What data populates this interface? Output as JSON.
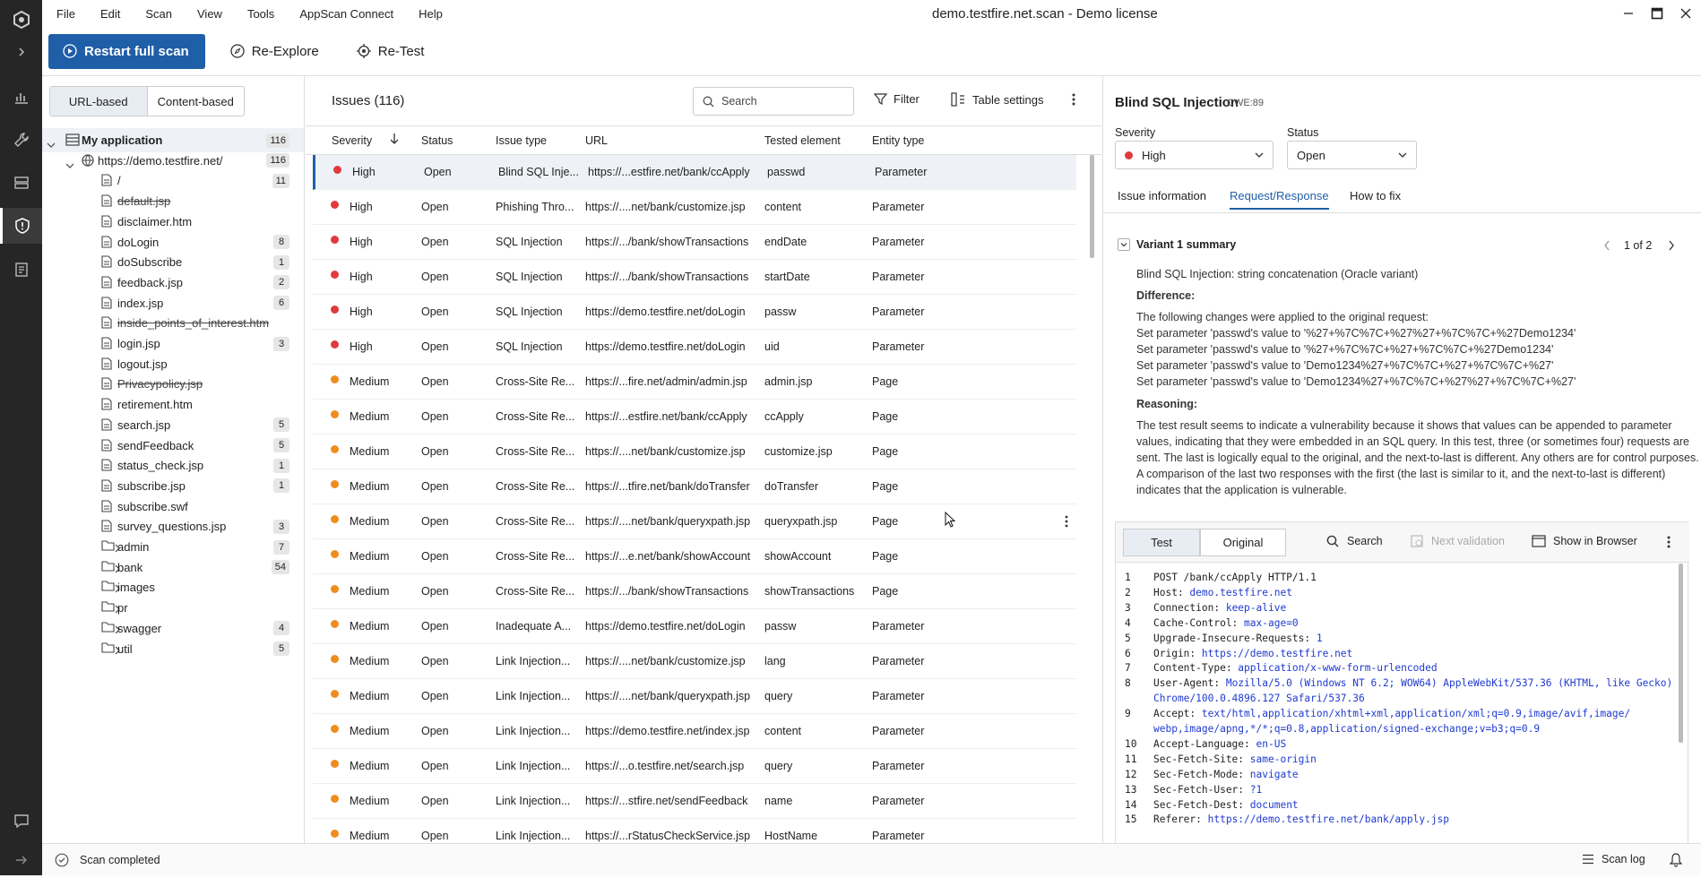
{
  "window": {
    "title": "demo.testfire.net.scan - Demo license"
  },
  "menu": [
    "File",
    "Edit",
    "Scan",
    "View",
    "Tools",
    "AppScan Connect",
    "Help"
  ],
  "toolbar": {
    "restart": "Restart full scan",
    "reexplore": "Re-Explore",
    "retest": "Re-Test"
  },
  "tree": {
    "tab_url": "URL-based",
    "tab_content": "Content-based",
    "items": [
      {
        "label": "My application",
        "count": "116",
        "kind": "app",
        "level": 0,
        "strike": false
      },
      {
        "label": "https://demo.testfire.net/",
        "count": "116",
        "kind": "globe",
        "level": 1,
        "strike": false
      },
      {
        "label": "/",
        "count": "11",
        "kind": "file",
        "level": 2,
        "strike": false
      },
      {
        "label": "default.jsp",
        "count": "",
        "kind": "file",
        "level": 2,
        "strike": true
      },
      {
        "label": "disclaimer.htm",
        "count": "",
        "kind": "file",
        "level": 2,
        "strike": false
      },
      {
        "label": "doLogin",
        "count": "8",
        "kind": "file",
        "level": 2,
        "strike": false
      },
      {
        "label": "doSubscribe",
        "count": "1",
        "kind": "file",
        "level": 2,
        "strike": false
      },
      {
        "label": "feedback.jsp",
        "count": "2",
        "kind": "file",
        "level": 2,
        "strike": false
      },
      {
        "label": "index.jsp",
        "count": "6",
        "kind": "file",
        "level": 2,
        "strike": false
      },
      {
        "label": "inside_points_of_interest.htm",
        "count": "",
        "kind": "file",
        "level": 2,
        "strike": true
      },
      {
        "label": "login.jsp",
        "count": "3",
        "kind": "file",
        "level": 2,
        "strike": false
      },
      {
        "label": "logout.jsp",
        "count": "",
        "kind": "file",
        "level": 2,
        "strike": false
      },
      {
        "label": "Privacypolicy.jsp",
        "count": "",
        "kind": "file",
        "level": 2,
        "strike": true
      },
      {
        "label": "retirement.htm",
        "count": "",
        "kind": "file",
        "level": 2,
        "strike": false
      },
      {
        "label": "search.jsp",
        "count": "5",
        "kind": "file",
        "level": 2,
        "strike": false
      },
      {
        "label": "sendFeedback",
        "count": "5",
        "kind": "file",
        "level": 2,
        "strike": false
      },
      {
        "label": "status_check.jsp",
        "count": "1",
        "kind": "file",
        "level": 2,
        "strike": false
      },
      {
        "label": "subscribe.jsp",
        "count": "1",
        "kind": "file",
        "level": 2,
        "strike": false
      },
      {
        "label": "subscribe.swf",
        "count": "",
        "kind": "file",
        "level": 2,
        "strike": false
      },
      {
        "label": "survey_questions.jsp",
        "count": "3",
        "kind": "file",
        "level": 2,
        "strike": false
      },
      {
        "label": "admin",
        "count": "7",
        "kind": "folder",
        "level": 2,
        "strike": false
      },
      {
        "label": "bank",
        "count": "54",
        "kind": "folder",
        "level": 2,
        "strike": false
      },
      {
        "label": "images",
        "count": "",
        "kind": "folder",
        "level": 2,
        "strike": false
      },
      {
        "label": "pr",
        "count": "",
        "kind": "folder",
        "level": 2,
        "strike": false
      },
      {
        "label": "swagger",
        "count": "4",
        "kind": "folder",
        "level": 2,
        "strike": false
      },
      {
        "label": "util",
        "count": "5",
        "kind": "folder",
        "level": 2,
        "strike": false
      }
    ]
  },
  "issues": {
    "title": "Issues (116)",
    "search_placeholder": "Search",
    "filter": "Filter",
    "table_settings": "Table settings",
    "columns": [
      "Severity",
      "Status",
      "Issue type",
      "URL",
      "Tested element",
      "Entity type"
    ],
    "rows": [
      [
        "High",
        "Open",
        "Blind SQL Inje...",
        "https://...estfire.net/bank/ccApply",
        "passwd",
        "Parameter"
      ],
      [
        "High",
        "Open",
        "Phishing Thro...",
        "https://....net/bank/customize.jsp",
        "content",
        "Parameter"
      ],
      [
        "High",
        "Open",
        "SQL Injection",
        "https://.../bank/showTransactions",
        "endDate",
        "Parameter"
      ],
      [
        "High",
        "Open",
        "SQL Injection",
        "https://.../bank/showTransactions",
        "startDate",
        "Parameter"
      ],
      [
        "High",
        "Open",
        "SQL Injection",
        "https://demo.testfire.net/doLogin",
        "passw",
        "Parameter"
      ],
      [
        "High",
        "Open",
        "SQL Injection",
        "https://demo.testfire.net/doLogin",
        "uid",
        "Parameter"
      ],
      [
        "Medium",
        "Open",
        "Cross-Site Re...",
        "https://...fire.net/admin/admin.jsp",
        "admin.jsp",
        "Page"
      ],
      [
        "Medium",
        "Open",
        "Cross-Site Re...",
        "https://...estfire.net/bank/ccApply",
        "ccApply",
        "Page"
      ],
      [
        "Medium",
        "Open",
        "Cross-Site Re...",
        "https://....net/bank/customize.jsp",
        "customize.jsp",
        "Page"
      ],
      [
        "Medium",
        "Open",
        "Cross-Site Re...",
        "https://...tfire.net/bank/doTransfer",
        "doTransfer",
        "Page"
      ],
      [
        "Medium",
        "Open",
        "Cross-Site Re...",
        "https://....net/bank/queryxpath.jsp",
        "queryxpath.jsp",
        "Page"
      ],
      [
        "Medium",
        "Open",
        "Cross-Site Re...",
        "https://...e.net/bank/showAccount",
        "showAccount",
        "Page"
      ],
      [
        "Medium",
        "Open",
        "Cross-Site Re...",
        "https://.../bank/showTransactions",
        "showTransactions",
        "Page"
      ],
      [
        "Medium",
        "Open",
        "Inadequate A...",
        "https://demo.testfire.net/doLogin",
        "passw",
        "Parameter"
      ],
      [
        "Medium",
        "Open",
        "Link Injection...",
        "https://....net/bank/customize.jsp",
        "lang",
        "Parameter"
      ],
      [
        "Medium",
        "Open",
        "Link Injection...",
        "https://....net/bank/queryxpath.jsp",
        "query",
        "Parameter"
      ],
      [
        "Medium",
        "Open",
        "Link Injection...",
        "https://demo.testfire.net/index.jsp",
        "content",
        "Parameter"
      ],
      [
        "Medium",
        "Open",
        "Link Injection...",
        "https://...o.testfire.net/search.jsp",
        "query",
        "Parameter"
      ],
      [
        "Medium",
        "Open",
        "Link Injection...",
        "https://...stfire.net/sendFeedback",
        "name",
        "Parameter"
      ],
      [
        "Medium",
        "Open",
        "Link Injection...",
        "https://...rStatusCheckService.jsp",
        "HostName",
        "Parameter"
      ]
    ]
  },
  "details": {
    "title": "Blind SQL Injection",
    "cwe": "CWE:89",
    "severity_label": "Severity",
    "severity_value": "High",
    "status_label": "Status",
    "status_value": "Open",
    "tabs": [
      "Issue information",
      "Request/Response",
      "How to fix"
    ],
    "variant_title": "Variant 1 summary",
    "variant_pager": "1 of 2",
    "summary": "Blind SQL Injection: string concatenation (Oracle variant)",
    "difference_label": "Difference:",
    "difference_intro": "The following changes were applied to the original request:",
    "changes": [
      "Set parameter 'passwd's value to '%27+%7C%7C+%27%27+%7C%7C+%27Demo1234'",
      "Set parameter 'passwd's value to '%27+%7C%7C+%27+%7C%7C+%27Demo1234'",
      "Set parameter 'passwd's value to 'Demo1234%27+%7C%7C+%27+%7C%7C+%27'",
      "Set parameter 'passwd's value to 'Demo1234%27+%7C%7C+%27%27+%7C%7C+%27'"
    ],
    "reasoning_label": "Reasoning:",
    "reasoning_lines": [
      "The test result seems to indicate a vulnerability because it shows that values can be appended to parameter",
      "values, indicating that they were embedded in an SQL query. In this test, three (or sometimes four) requests are",
      "sent. The last is logically equal to the original, and the next-to-last is different. Any others are for control purposes.",
      "A comparison of the last two responses with the first (the last is similar to it, and the next-to-last is different)",
      "indicates that the application is vulnerable."
    ],
    "rr_tabs": [
      "Test",
      "Original"
    ],
    "rr_search": "Search",
    "rr_next": "Next validation",
    "rr_show": "Show in Browser",
    "request_lines": [
      {
        "n": "1",
        "k": "POST /bank/ccApply HTTP/1.1",
        "v": ""
      },
      {
        "n": "2",
        "k": "Host: ",
        "v": "demo.testfire.net"
      },
      {
        "n": "3",
        "k": "Connection: ",
        "v": "keep-alive"
      },
      {
        "n": "4",
        "k": "Cache-Control: ",
        "v": "max-age=0"
      },
      {
        "n": "5",
        "k": "Upgrade-Insecure-Requests: ",
        "v": "1"
      },
      {
        "n": "6",
        "k": "Origin: ",
        "v": "https://demo.testfire.net"
      },
      {
        "n": "7",
        "k": "Content-Type: ",
        "v": "application/x-www-form-urlencoded"
      },
      {
        "n": "8",
        "k": "User-Agent: ",
        "v": "Mozilla/5.0 (Windows NT 6.2; WOW64) AppleWebKit/537.36 (KHTML, like Gecko)"
      },
      {
        "n": "",
        "k": "",
        "v": "Chrome/100.0.4896.127 Safari/537.36"
      },
      {
        "n": "9",
        "k": "Accept: ",
        "v": "text/html,application/xhtml+xml,application/xml;q=0.9,image/avif,image/"
      },
      {
        "n": "",
        "k": "",
        "v": "webp,image/apng,*/*;q=0.8,application/signed-exchange;v=b3;q=0.9"
      },
      {
        "n": "10",
        "k": "Accept-Language: ",
        "v": "en-US"
      },
      {
        "n": "11",
        "k": "Sec-Fetch-Site: ",
        "v": "same-origin"
      },
      {
        "n": "12",
        "k": "Sec-Fetch-Mode: ",
        "v": "navigate"
      },
      {
        "n": "13",
        "k": "Sec-Fetch-User: ",
        "v": "?1"
      },
      {
        "n": "14",
        "k": "Sec-Fetch-Dest: ",
        "v": "document"
      },
      {
        "n": "15",
        "k": "Referer: ",
        "v": "https://demo.testfire.net/bank/apply.jsp"
      }
    ]
  },
  "status": {
    "text": "Scan completed",
    "scan_log": "Scan log"
  },
  "colors": {
    "accent": "#1f5fa8",
    "high": "#e0393e",
    "medium": "#f08c1e",
    "rail": "#262626"
  }
}
